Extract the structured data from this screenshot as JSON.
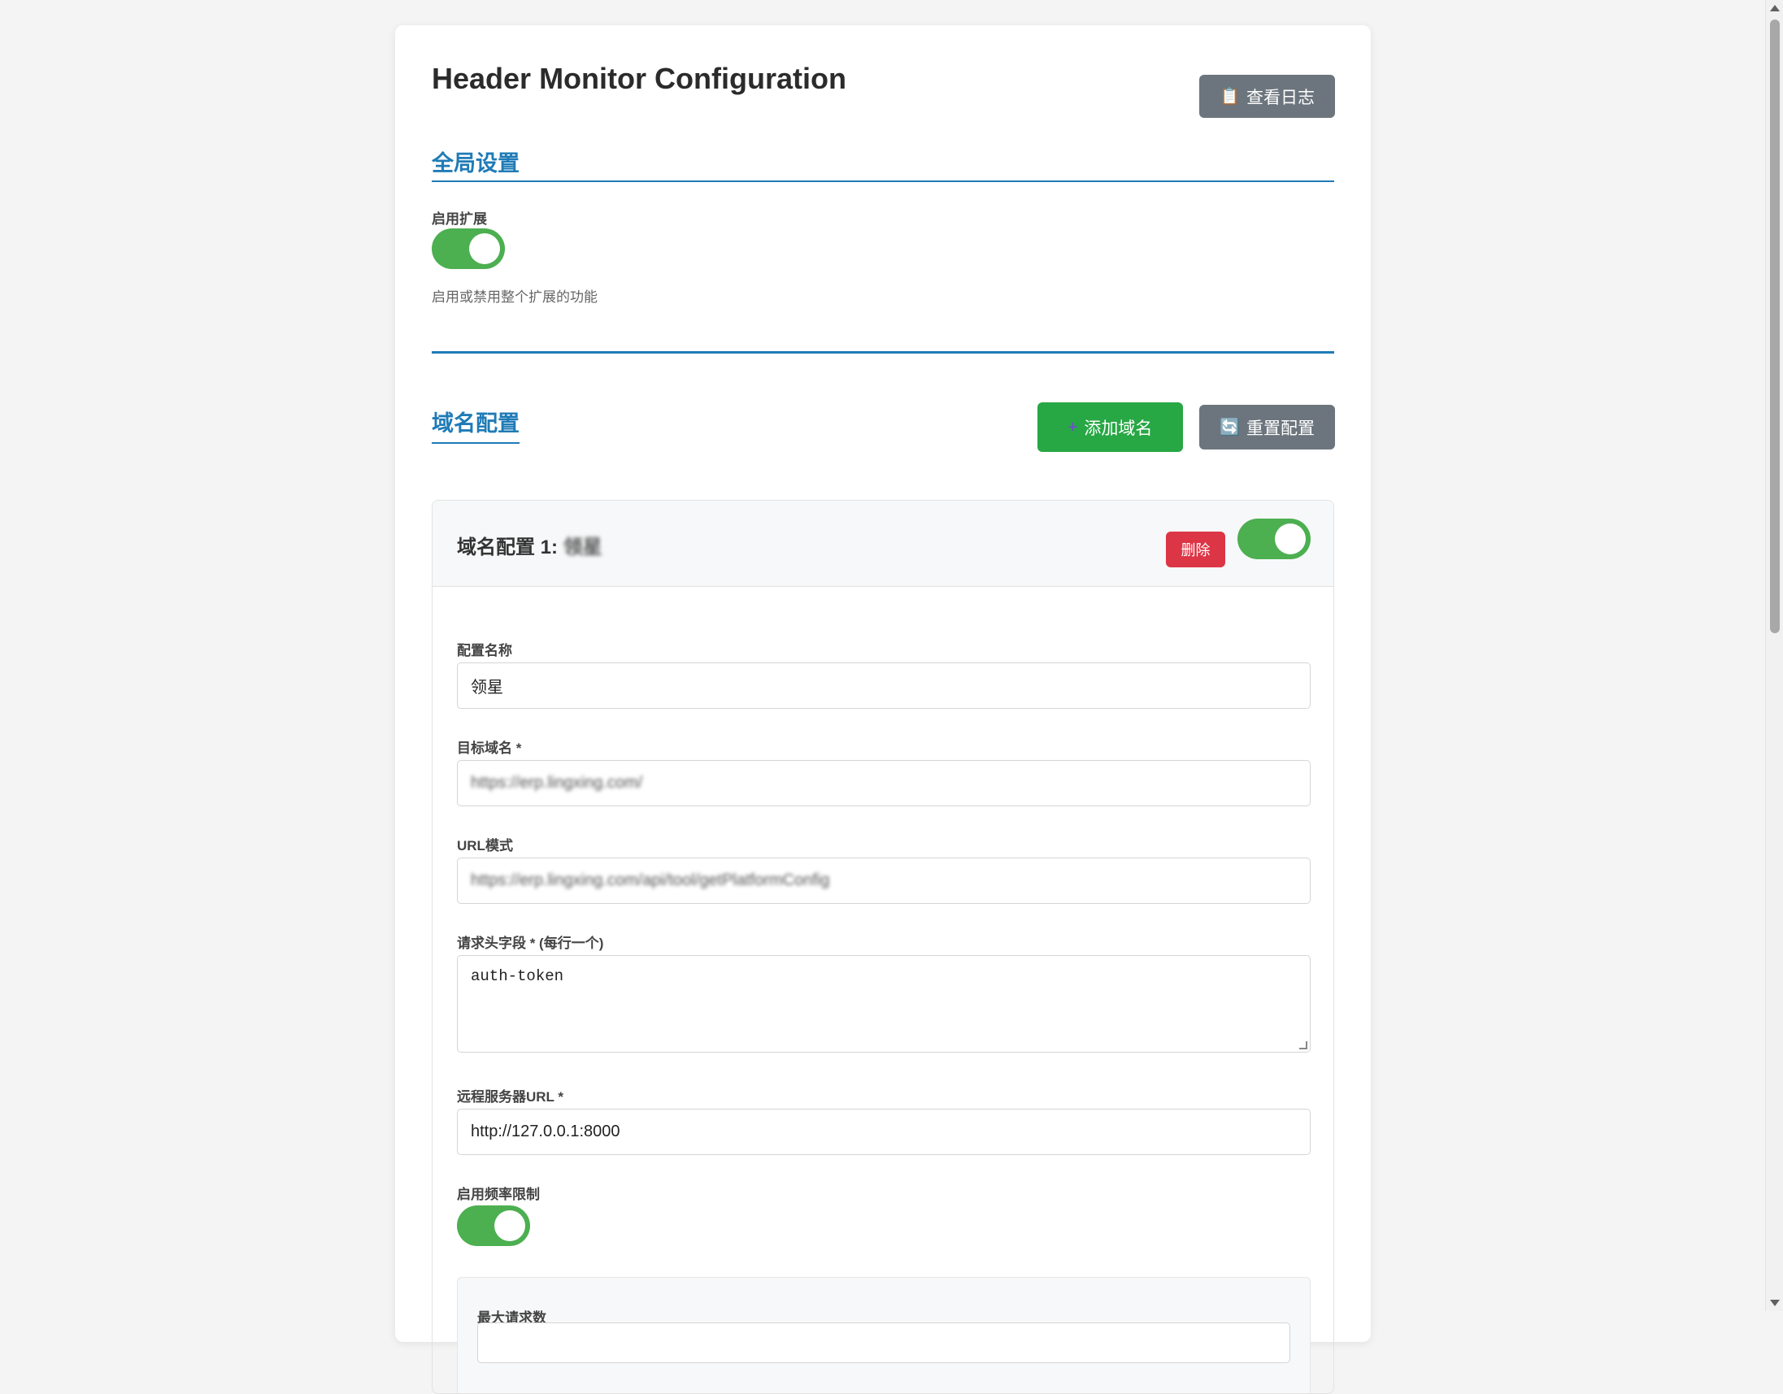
{
  "header": {
    "title": "Header Monitor Configuration",
    "logs_button": {
      "icon": "📋",
      "label": "查看日志"
    }
  },
  "global": {
    "section_title": "全局设置",
    "enable_label": "启用扩展",
    "enable_on": true,
    "help": "启用或禁用整个扩展的功能"
  },
  "domains": {
    "section_title": "域名配置",
    "add_button": {
      "icon": "➕",
      "label": "添加域名"
    },
    "reset_button": {
      "icon": "🔄",
      "label": "重置配置"
    }
  },
  "card": {
    "title_prefix": "域名配置 1:",
    "title_blurred": "领星",
    "delete_label": "删除",
    "enabled": true,
    "name_label": "配置名称",
    "name_value": "领星",
    "domain_label": "目标域名 *",
    "domain_value": "https://erp.lingxing.com/",
    "url_pattern_label": "URL模式",
    "url_pattern_value": "https://erp.lingxing.com/api/tool/getPlatformConfig",
    "headers_label": "请求头字段 * (每行一个)",
    "headers_value": "auth-token",
    "server_label": "远程服务器URL *",
    "server_value": "http://127.0.0.1:8000",
    "rate_limit_label": "启用频率限制",
    "rate_limit_on": true,
    "max_requests_label": "最大请求数"
  }
}
